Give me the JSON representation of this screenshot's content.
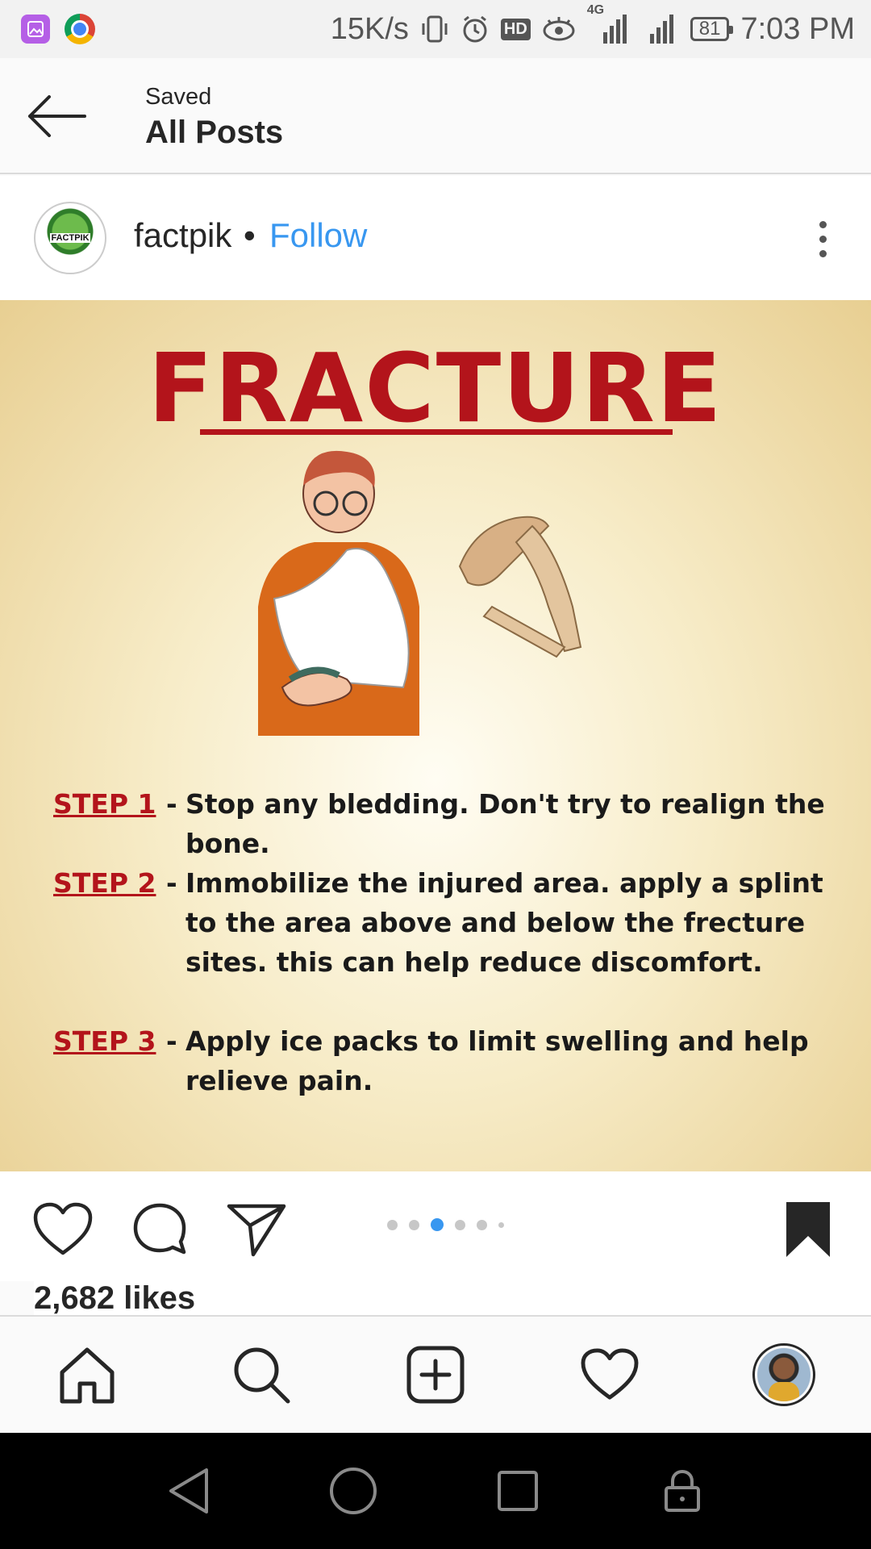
{
  "status_bar": {
    "net_speed": "15K/s",
    "hd_label": "HD",
    "network_label": "4G",
    "battery": "81",
    "time": "7:03 PM"
  },
  "header": {
    "subtitle": "Saved",
    "title": "All Posts"
  },
  "post": {
    "username": "factpik",
    "separator": "•",
    "follow_label": "Follow",
    "avatar_text": "FACTPIK",
    "image": {
      "title": "FRACTURE",
      "steps": [
        {
          "label": "STEP 1",
          "dash": "-",
          "text": "Stop any bledding. Don't try to realign the bone."
        },
        {
          "label": "STEP 2",
          "dash": "-",
          "text": "Immobilize the injured area. apply a splint to the area above and below the frecture sites. this can help reduce discomfort."
        },
        {
          "label": "STEP 3",
          "dash": "-",
          "text": "Apply ice packs to limit swelling and help relieve pain."
        }
      ]
    },
    "carousel": {
      "count": 6,
      "active_index": 2
    },
    "likes": "2,682 likes"
  },
  "icons": {
    "back": "back-arrow-icon",
    "more": "more-vertical-icon",
    "like": "heart-icon",
    "comment": "comment-icon",
    "share": "send-icon",
    "save": "bookmark-filled-icon",
    "home": "home-icon",
    "search": "search-icon",
    "new_post": "add-post-icon",
    "activity": "heart-icon",
    "profile": "profile-avatar"
  },
  "colors": {
    "accent": "#3897f0",
    "title_red": "#b3141b",
    "text": "#262626"
  }
}
